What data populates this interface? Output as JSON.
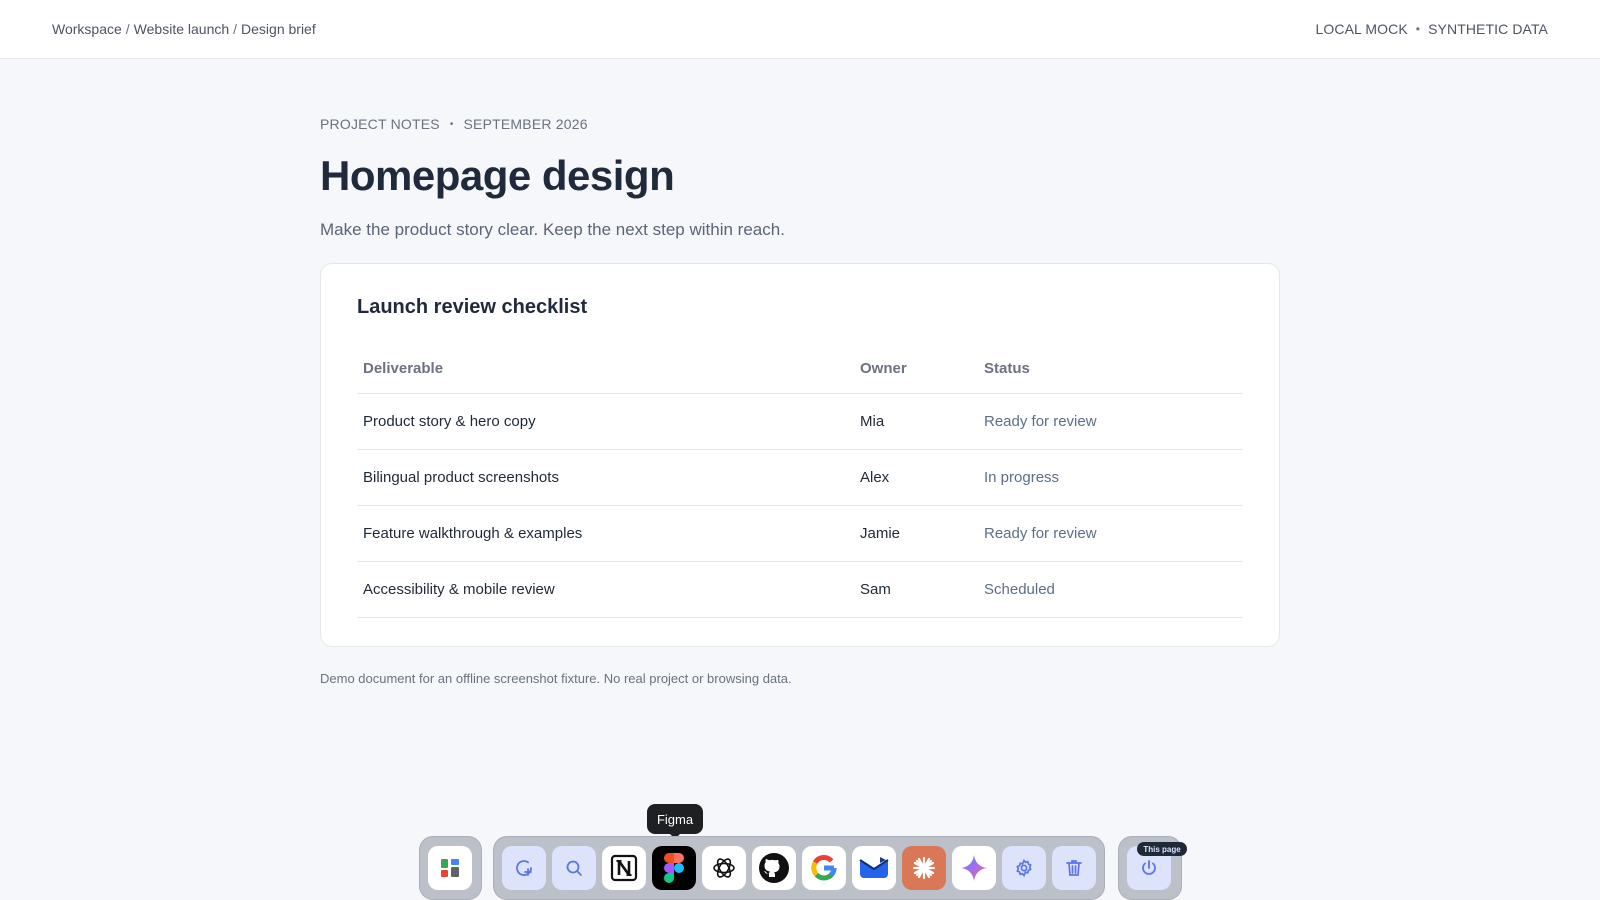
{
  "topbar": {
    "breadcrumb": [
      "Workspace",
      "Website launch",
      "Design brief"
    ],
    "separator": "/",
    "right_items": [
      "LOCAL MOCK",
      "SYNTHETIC DATA"
    ],
    "dot": "•"
  },
  "doc": {
    "eyebrow_left": "PROJECT NOTES",
    "eyebrow_right": "SEPTEMBER 2026",
    "title": "Homepage design",
    "subtitle": "Make the product story clear. Keep the next step within reach.",
    "footnote": "Demo document for an offline screenshot fixture. No real project or browsing data."
  },
  "checklist": {
    "title": "Launch review checklist",
    "columns": [
      "Deliverable",
      "Owner",
      "Status"
    ],
    "rows": [
      {
        "deliverable": "Product story & hero copy",
        "owner": "Mia",
        "status": "Ready for review"
      },
      {
        "deliverable": "Bilingual product screenshots",
        "owner": "Alex",
        "status": "In progress"
      },
      {
        "deliverable": "Feature walkthrough & examples",
        "owner": "Jamie",
        "status": "Ready for review"
      },
      {
        "deliverable": "Accessibility & mobile review",
        "owner": "Sam",
        "status": "Scheduled"
      }
    ]
  },
  "dock": {
    "tooltip": "Figma",
    "badge": "This page",
    "items": [
      {
        "name": "launcher-icon"
      },
      {
        "name": "new-chat-icon"
      },
      {
        "name": "search-icon"
      },
      {
        "name": "notion-icon"
      },
      {
        "name": "figma-icon"
      },
      {
        "name": "chatgpt-icon"
      },
      {
        "name": "github-icon"
      },
      {
        "name": "google-icon"
      },
      {
        "name": "mail-icon"
      },
      {
        "name": "claude-icon"
      },
      {
        "name": "gemini-icon"
      },
      {
        "name": "settings-icon"
      },
      {
        "name": "trash-icon"
      },
      {
        "name": "power-icon"
      }
    ],
    "accent": "#5b74e8"
  }
}
